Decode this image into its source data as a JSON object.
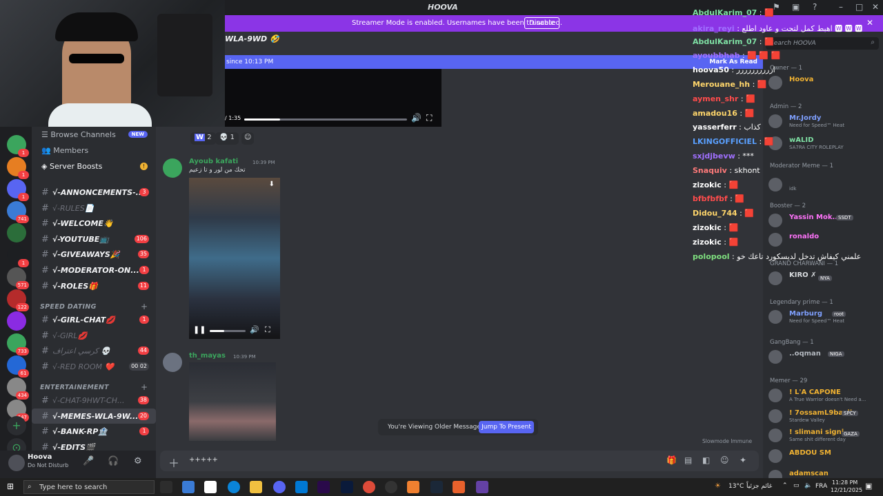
{
  "window": {
    "title": "HOOVA"
  },
  "banner": {
    "message": "Streamer Mode is enabled. Usernames have been truncated.",
    "disable_label": "Disable"
  },
  "channel": {
    "header": "WLA-9WD 🤣",
    "new_since": "since 10:13 PM",
    "mark_read": "Mark As Read"
  },
  "video1": {
    "time": "/ 1:35"
  },
  "reactions": [
    {
      "icon": "W",
      "count": "2"
    },
    {
      "icon": "💀",
      "count": "1"
    }
  ],
  "sidebar": {
    "browse": "Browse Channels",
    "new_badge": "NEW",
    "members": "Members",
    "boosts": "Server Boosts",
    "channels": [
      {
        "name": "√-ANNONCEMENTS-...",
        "count": "3"
      },
      {
        "name": "√-RULES📄",
        "count": ""
      },
      {
        "name": "√-WELCOME👋",
        "count": ""
      },
      {
        "name": "√-YOUTUBE📺",
        "count": "106"
      },
      {
        "name": "√-GIVEAWAYS🎉",
        "count": "35"
      },
      {
        "name": "√-MODERATOR-ON...",
        "count": "1"
      },
      {
        "name": "√-ROLES🎁",
        "count": "11"
      }
    ],
    "cat_speed": "SPEED DATING",
    "speed": [
      {
        "name": "√-GIRL-CHAT💋",
        "count": "1"
      },
      {
        "name": "√-GIRL💋",
        "count": ""
      },
      {
        "name": "كرسي اعتراف 💀",
        "count": "44"
      },
      {
        "name": "√-RED ROOM ❤️",
        "count": "00 02"
      }
    ],
    "cat_ent": "ENTERTAINEMENT",
    "ent": [
      {
        "name": "√-CHAT-9HWT-CH...",
        "count": "38"
      },
      {
        "name": "√-MEMES-WLA-9W...",
        "count": "20"
      },
      {
        "name": "√-BANK-RP🏦",
        "count": "1"
      },
      {
        "name": "√-EDITS🎬",
        "count": ""
      }
    ]
  },
  "servers": [
    {
      "badge": "1"
    },
    {
      "badge": "1"
    },
    {
      "badge": "1"
    },
    {
      "badge": "741"
    },
    {
      "badge": ""
    },
    {
      "badge": "1"
    },
    {
      "badge": "571"
    },
    {
      "badge": "122"
    },
    {
      "badge": ""
    },
    {
      "badge": "733"
    },
    {
      "badge": "61"
    },
    {
      "badge": "434"
    },
    {
      "badge": "647"
    }
  ],
  "user": {
    "name": "Hoova",
    "status": "Do Not Disturb"
  },
  "messages": [
    {
      "author": "Ayoub kafati",
      "time": "10:39 PM",
      "text": "تحك من لور و تا زعيم"
    },
    {
      "author": "th_mayas",
      "time": "10:39 PM",
      "text": ""
    }
  ],
  "older": {
    "text": "You're Viewing Older Messages",
    "button": "Jump To Present"
  },
  "slowmode": "Slowmode Immune",
  "composer": {
    "value": "+++++"
  },
  "stream_chat": [
    {
      "user": "AbdulKarim_07",
      "color": "#7fe0a4",
      "text": ": 🟥"
    },
    {
      "user": "akira_reyi",
      "color": "#a070ff",
      "text": ": اهبط كمل لتحت و عاود اطلع 🆆 🆆 🆆"
    },
    {
      "user": "AbdulKarim_07",
      "color": "#7fe0a4",
      "text": ": 🟥"
    },
    {
      "user": "ayoubbhab",
      "color": "#a070ff",
      "text": ": 🟥 🟥 🟥"
    },
    {
      "user": "hoova50",
      "color": "#ffffff",
      "text": ": ارررررررررر"
    },
    {
      "user": "Merouane_hh",
      "color": "#ffd66b",
      "text": ": 🟥"
    },
    {
      "user": "aymen_shr",
      "color": "#ff4c4c",
      "text": ": 🟥"
    },
    {
      "user": "amadou16",
      "color": "#ffd66b",
      "text": ": 🟥"
    },
    {
      "user": "yasserferr",
      "color": "#ffffff",
      "text": ": كذاب"
    },
    {
      "user": "LKINGOFFICIEL",
      "color": "#5aa0ff",
      "text": ": 🟥"
    },
    {
      "user": "sxjdjbevw",
      "color": "#a070ff",
      "text": ": ***"
    },
    {
      "user": "Snaquiv",
      "color": "#ff7a7a",
      "text": ": skhont"
    },
    {
      "user": "zizokic",
      "color": "#ffffff",
      "text": ": 🟥"
    },
    {
      "user": "bfbfbfbf",
      "color": "#ff4c4c",
      "text": ": 🟥"
    },
    {
      "user": "Didou_744",
      "color": "#ffd66b",
      "text": ": 🟥"
    },
    {
      "user": "zizokic",
      "color": "#ffffff",
      "text": ": 🟥"
    },
    {
      "user": "zizokic",
      "color": "#ffffff",
      "text": ": 🟥"
    },
    {
      "user": "polopool",
      "color": "#7fe07f",
      "text": ": علمني كيفاش تدخل لديسكورد تاعك خو"
    }
  ],
  "member_list": {
    "search": "Search HOOVA",
    "groups": [
      {
        "role": "Owner — 1",
        "members": [
          {
            "name": "Hoova",
            "color": "#f0b232",
            "sub": ""
          }
        ]
      },
      {
        "role": "Admin — 2",
        "members": [
          {
            "name": "Mr.Jordy",
            "color": "#7fa0ff",
            "sub": "Need for Speed™ Heat"
          },
          {
            "name": "wALID",
            "color": "#7fe0a4",
            "sub": "SA7RA CITY ROLEPLAY"
          }
        ]
      },
      {
        "role": "Moderator Meme — 1",
        "members": [
          {
            "name": "",
            "color": "#b5bac1",
            "sub": "idk"
          }
        ]
      },
      {
        "role": "Booster — 2",
        "members": [
          {
            "name": "Yassin Mok...",
            "color": "#ff73fa",
            "sub": ""
          },
          {
            "name": "ronaldo",
            "color": "#ff73fa",
            "sub": ""
          }
        ]
      },
      {
        "role": "GRAND CHARWANI — 1",
        "members": [
          {
            "name": "KIRO ✗",
            "color": "#dbdee1",
            "sub": ""
          }
        ]
      },
      {
        "role": "Legendary prime — 1",
        "members": [
          {
            "name": "Marburg",
            "color": "#7fa0ff",
            "sub": "Need for Speed™ Heat"
          }
        ]
      },
      {
        "role": "GangBang — 1",
        "members": [
          {
            "name": "..oqman",
            "color": "#b5bac1",
            "sub": ""
          }
        ]
      },
      {
        "role": "Memer — 29",
        "members": [
          {
            "name": "! L'A CAPONE",
            "color": "#f0b232",
            "sub": "A True Warrior doesn't Need a..."
          },
          {
            "name": "! 7ossamL9bayli",
            "color": "#f0b232",
            "sub": "Stardew Valley"
          },
          {
            "name": "! slimani signi...",
            "color": "#f0b232",
            "sub": "Same shit different day"
          },
          {
            "name": "ABDOU SM",
            "color": "#f0b232",
            "sub": ""
          },
          {
            "name": "adamscan",
            "color": "#f0b232",
            "sub": ""
          }
        ]
      }
    ],
    "tags": {
      "ssdt": "SSDT",
      "nya": "NYA",
      "root": "root",
      "niga": "NIGA",
      "spcy": "SPCY",
      "gaza": "GAZA"
    }
  },
  "taskbar": {
    "search_placeholder": "Type here to search",
    "weather": "13°C",
    "weather_text": "غائم جزئياً",
    "lang": "FRA",
    "time": "11:28 PM",
    "date": "12/21/2025"
  }
}
